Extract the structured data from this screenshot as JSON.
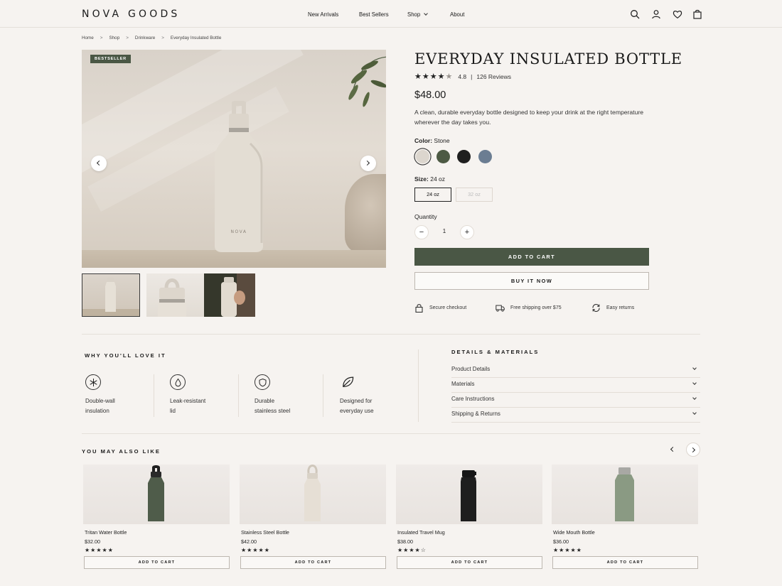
{
  "brand": {
    "logo": "NOVA GOODS"
  },
  "nav": {
    "items": [
      "New Arrivals",
      "Best Sellers",
      "Shop",
      "About"
    ]
  },
  "breadcrumb": {
    "items": [
      "Home",
      "Shop",
      "Drinkware",
      "Everyday Insulated Bottle"
    ]
  },
  "gallery": {
    "badge": "BESTSELLER",
    "bottle_brand": "NOVA"
  },
  "product": {
    "title": "EVERYDAY INSULATED BOTTLE",
    "rating": "4.8",
    "reviews": "126 Reviews",
    "price": "$48.00",
    "description": "A clean, durable everyday bottle designed to keep your drink at the right temperature wherever the day takes you.",
    "color_label": "Color:",
    "color_value": "Stone",
    "colors": [
      "#dcd6ce",
      "#4d5a44",
      "#1f1f1f",
      "#6b7d92"
    ],
    "size_label": "Size:",
    "size_value": "24 oz",
    "sizes": [
      "24 oz",
      "32 oz"
    ],
    "quantity_label": "Quantity",
    "quantity": "1",
    "add_to_cart": "ADD TO CART",
    "buy_now": "BUY IT NOW",
    "perks": [
      "Secure checkout",
      "Free shipping over $75",
      "Easy returns"
    ]
  },
  "features": {
    "title": "WHY YOU'LL LOVE IT",
    "items": [
      {
        "line1": "Double-wall",
        "line2": "insulation"
      },
      {
        "line1": "Leak-resistant",
        "line2": "lid"
      },
      {
        "line1": "Durable",
        "line2": "stainless steel"
      },
      {
        "line1": "Designed for",
        "line2": "everyday use"
      }
    ]
  },
  "details": {
    "title": "DETAILS & MATERIALS",
    "items": [
      "Product Details",
      "Materials",
      "Care Instructions",
      "Shipping & Returns"
    ]
  },
  "related": {
    "title": "YOU MAY ALSO LIKE",
    "button_label": "ADD TO CART",
    "items": [
      {
        "name": "Tritan Water Bottle",
        "price": "$32.00",
        "stars": "★★★★★",
        "color": "#4f5c4a"
      },
      {
        "name": "Stainless Steel Bottle",
        "price": "$42.00",
        "stars": "★★★★★",
        "color": "#e4ddd3"
      },
      {
        "name": "Insulated Travel Mug",
        "price": "$38.00",
        "stars": "★★★★☆",
        "color": "#1e1e1e"
      },
      {
        "name": "Wide Mouth Bottle",
        "price": "$36.00",
        "stars": "★★★★★",
        "color": "#8a9a83"
      }
    ]
  }
}
